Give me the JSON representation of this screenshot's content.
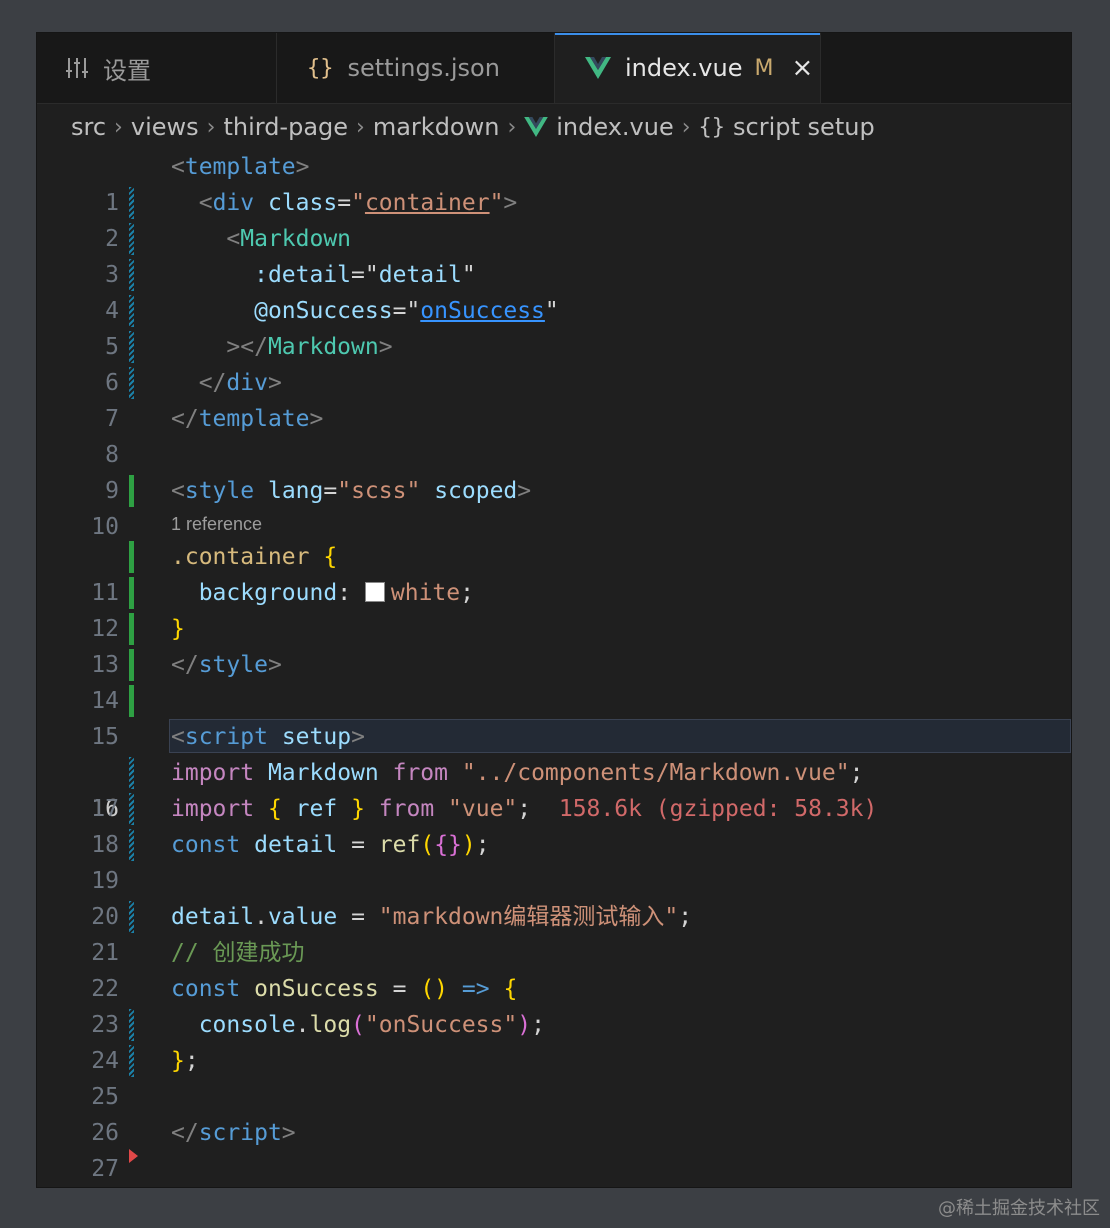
{
  "tabs": [
    {
      "label": "设置",
      "icon": "settings-sliders-icon",
      "active": false
    },
    {
      "label": "settings.json",
      "icon": "json-braces-icon",
      "active": false
    },
    {
      "label": "index.vue",
      "icon": "vue-logo-icon",
      "active": true,
      "status": "M",
      "close": "×"
    }
  ],
  "breadcrumb": [
    "src",
    "views",
    "third-page",
    "markdown",
    "index.vue",
    "script setup"
  ],
  "codelens": "1 reference",
  "lines": {
    "1": {
      "n": "1"
    },
    "2": {
      "n": "2"
    },
    "3": {
      "n": "3"
    },
    "4": {
      "n": "4"
    },
    "5": {
      "n": "5"
    },
    "6": {
      "n": "6"
    },
    "7": {
      "n": "7"
    },
    "8": {
      "n": "8"
    },
    "9": {
      "n": "9"
    },
    "10": {
      "n": "10"
    },
    "11": {
      "n": "11"
    },
    "12": {
      "n": "12"
    },
    "13": {
      "n": "13"
    },
    "14": {
      "n": "14"
    },
    "15": {
      "n": "15"
    },
    "16": {
      "n": "16"
    },
    "17": {
      "n": "17"
    },
    "18": {
      "n": "18"
    },
    "19": {
      "n": "19"
    },
    "20": {
      "n": "20"
    },
    "21": {
      "n": "21"
    },
    "22": {
      "n": "22"
    },
    "23": {
      "n": "23"
    },
    "24": {
      "n": "24"
    },
    "25": {
      "n": "25"
    },
    "26": {
      "n": "26"
    },
    "27": {
      "n": "27"
    }
  },
  "code": {
    "template": "template",
    "div": "div",
    "class_attr": "class",
    "container": "container",
    "markdown": "Markdown",
    "detail_attr": ":detail",
    "detail_val": "detail",
    "onsuccess_attr": "@onSuccess",
    "onsuccess_val": "onSuccess",
    "style": "style",
    "lang": "lang",
    "scss": "scss",
    "scoped": "scoped",
    "container_sel": ".container",
    "background": "background",
    "white": "white",
    "script": "script",
    "setup": "setup",
    "import": "import",
    "from": "from",
    "md_path": "\"../components/Markdown.vue\"",
    "ref": "ref",
    "vue_str": "\"vue\"",
    "import_cost": "158.6k (gzipped: 58.3k)",
    "const": "const",
    "detail_var": "detail",
    "value_prop": "value",
    "md_string": "\"markdown编辑器测试输入\"",
    "comment": "// 创建成功",
    "onsuccess_fn": "onSuccess",
    "console": "console",
    "log": "log",
    "onsuccess_str": "\"onSuccess\""
  },
  "watermark": "@稀土掘金技术社区",
  "colors": {
    "active_tab_accent": "#3b8eea",
    "added_gutter": "#2ea043",
    "modified_gutter": "#1b81a8",
    "modified_badge": "#c9a96e"
  }
}
